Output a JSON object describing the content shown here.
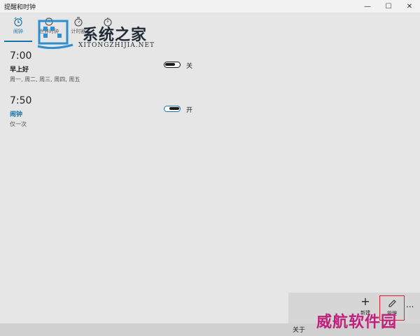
{
  "window": {
    "title": "提醒和时钟"
  },
  "tabs": [
    {
      "label": "闹钟",
      "icon": "alarm-clock-icon",
      "active": true
    },
    {
      "label": "世界时钟",
      "icon": "world-clock-icon",
      "active": false
    },
    {
      "label": "计时器",
      "icon": "timer-icon",
      "active": false
    }
  ],
  "alarms": [
    {
      "time": "7:00",
      "name": "早上好",
      "days": "周一, 周二, 周三, 周四, 周五",
      "state_label": "关",
      "on": false
    },
    {
      "time": "7:50",
      "name": "闹钟",
      "days": "仅一次",
      "state_label": "开",
      "on": true
    }
  ],
  "commands": {
    "new_label": "新建",
    "manage_label": "管理",
    "more": "..."
  },
  "footer": {
    "about": "关于"
  },
  "watermark": {
    "cn": "系统之家",
    "en": "XITONGZHIJIA.NET"
  },
  "brand": "威航软件园",
  "colors": {
    "accent": "#1a73a8",
    "highlight": "#e0202e",
    "brand": "#c0207a"
  }
}
